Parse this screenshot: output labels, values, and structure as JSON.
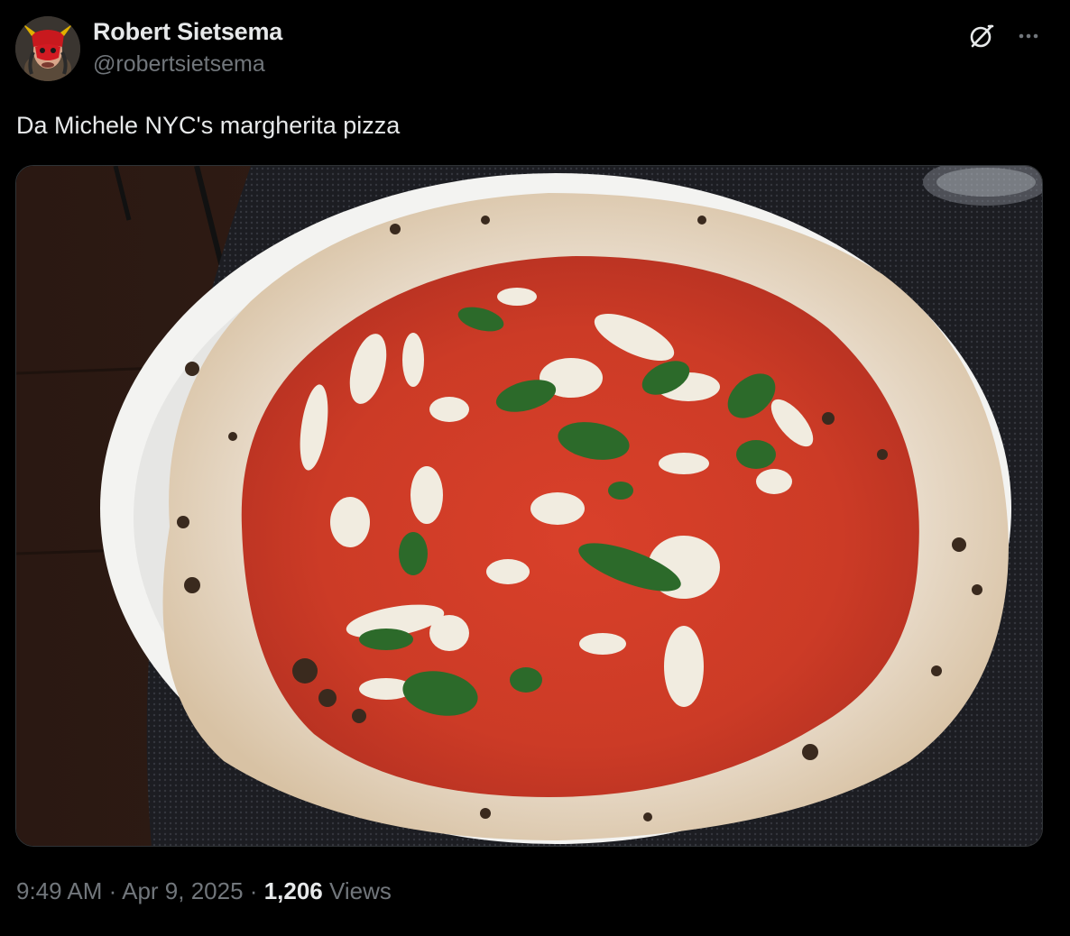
{
  "author": {
    "display_name": "Robert Sietsema",
    "handle": "@robertsietsema",
    "avatar_icon": "devil-mask-avatar"
  },
  "header_actions": {
    "grok_icon": "grok-icon",
    "more_icon": "more-icon",
    "more_glyph": "···"
  },
  "tweet": {
    "text": "Da Michele NYC's margherita pizza"
  },
  "media": {
    "type": "photo"
  },
  "meta": {
    "time": "9:49 AM",
    "separator": "·",
    "date": "Apr 9, 2025",
    "views_count": "1,206",
    "views_label": "Views"
  },
  "colors": {
    "background": "#000000",
    "primary_text": "#e7e9ea",
    "secondary_text": "#71767b",
    "border": "#2f3336"
  }
}
